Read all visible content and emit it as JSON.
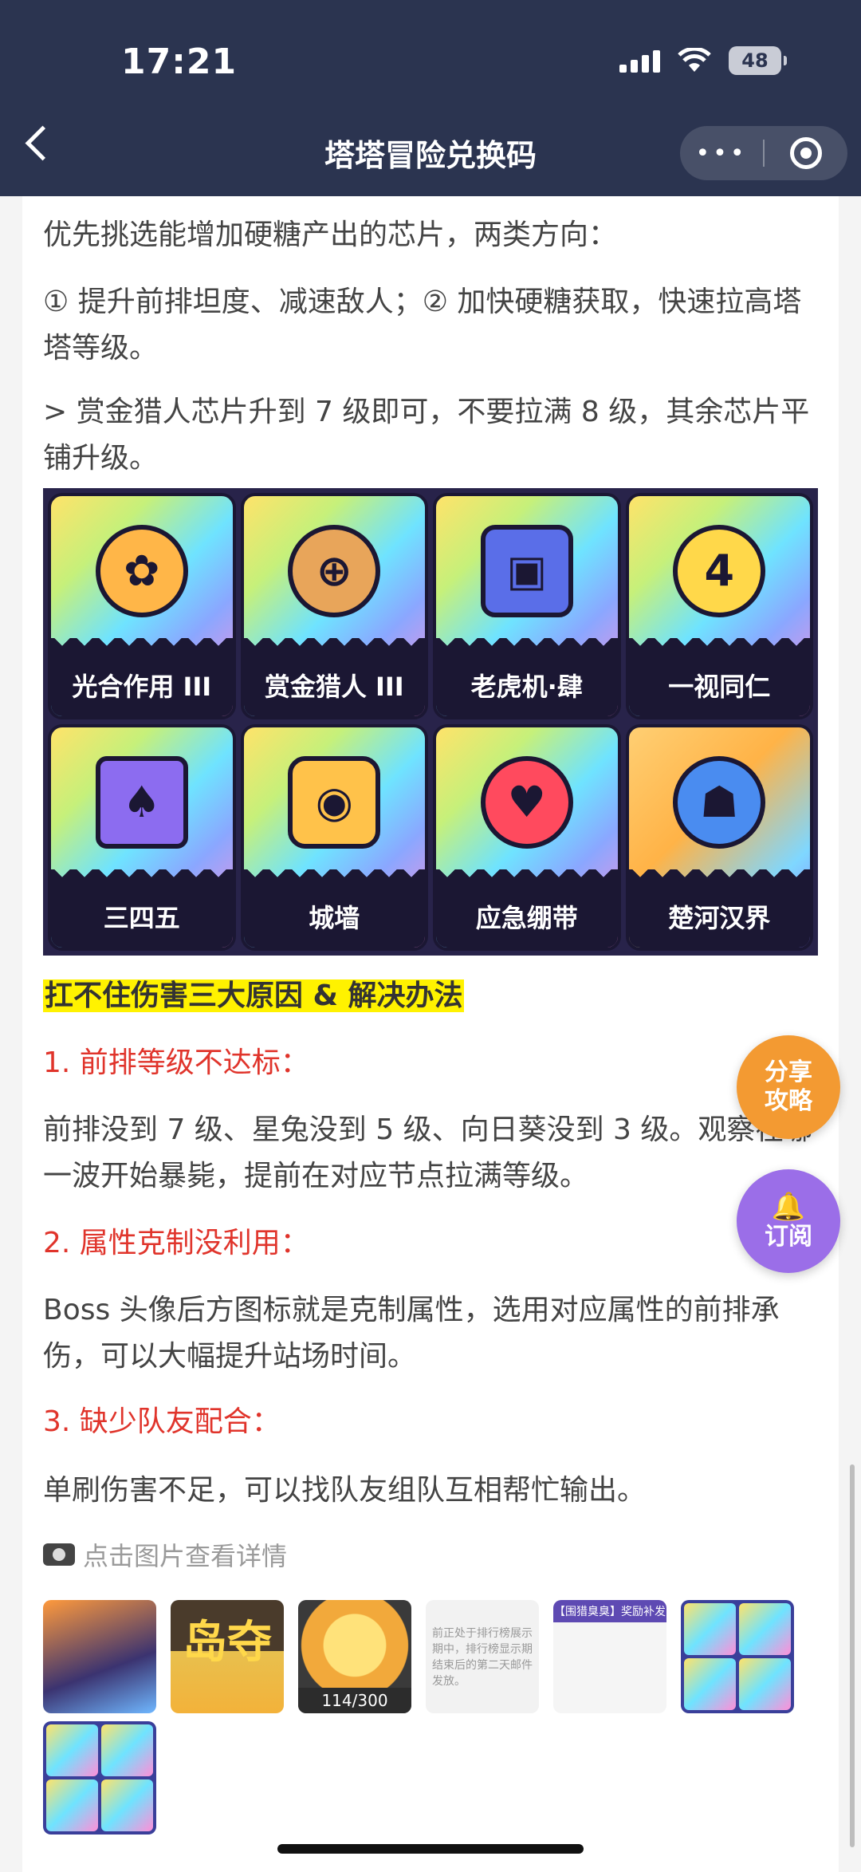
{
  "status_bar": {
    "time": "17:21",
    "battery": "48"
  },
  "nav": {
    "title": "塔塔冒险兑换码",
    "more_label": "•••"
  },
  "article": {
    "p1": "优先挑选能增加硬糖产出的芯片，两类方向：",
    "p2": "① 提升前排坦度、减速敌人；② 加快硬糖获取，快速拉高塔塔等级。",
    "p3": "> 赏金猎人芯片升到 7 级即可，不要拉满 8 级，其余芯片平铺升级。",
    "chips": [
      {
        "label": "光合作用 III",
        "symbol": "✿"
      },
      {
        "label": "赏金猎人 III",
        "symbol": "⊕"
      },
      {
        "label": "老虎机·肆",
        "symbol": "▣"
      },
      {
        "label": "一视同仁",
        "symbol": "4"
      },
      {
        "label": "三四五",
        "symbol": "♠"
      },
      {
        "label": "城墙",
        "symbol": "◉"
      },
      {
        "label": "应急绷带",
        "symbol": "♥"
      },
      {
        "label": "楚河汉界",
        "symbol": "☗"
      }
    ],
    "heading": "扛不住伤害三大原因 & 解决办法",
    "reason1_title": "1. 前排等级不达标：",
    "reason1_body": "前排没到 7 级、星兔没到 5 级、向日葵没到 3 级。观察在哪一波开始暴毙，提前在对应节点拉满等级。",
    "reason2_title": "2. 属性克制没利用：",
    "reason2_body": "Boss 头像后方图标就是克制属性，选用对应属性的前排承伤，可以大幅提升站场时间。",
    "reason3_title": "3. 缺少队友配合：",
    "reason3_body": "单刷伤害不足，可以找队友组队互相帮忙输出。"
  },
  "floating": {
    "share_line1": "分享",
    "share_line2": "攻略",
    "subscribe_label": "订阅"
  },
  "thumbs": {
    "title": "点击图片查看详情",
    "t2_text": "岛夺",
    "t3_text": "114/300",
    "t4_text": "前正处于排行榜展示期中，排行榜显示期结束后的第二天邮件发放。",
    "t5_text": "【围猎臭臭】奖励补发"
  }
}
